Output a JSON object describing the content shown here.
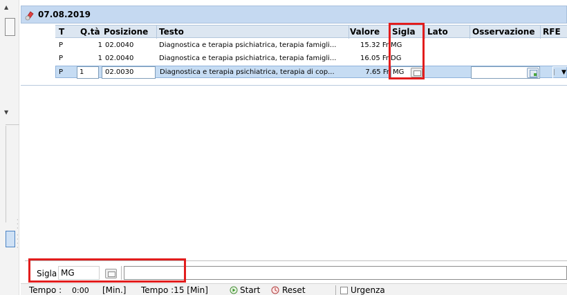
{
  "header": {
    "date": "07.08.2019"
  },
  "columns": {
    "t": "T",
    "qta": "Q.tà",
    "posizione": "Posizione",
    "testo": "Testo",
    "valore": "Valore",
    "sigla": "Sigla",
    "lato": "Lato",
    "osservazione": "Osservazione",
    "rfe": "RFE"
  },
  "rows": [
    {
      "t": "P",
      "qta": "1",
      "posizione": "02.0040",
      "testo": "Diagnostica e terapia psichiatrica, terapia famigli...",
      "valore": "15.32 Fr",
      "sigla": "MG"
    },
    {
      "t": "P",
      "qta": "1",
      "posizione": "02.0040",
      "testo": "Diagnostica e terapia psichiatrica, terapia famigli...",
      "valore": "16.05 Fr",
      "sigla": "DG"
    },
    {
      "t": "P",
      "qta": "1",
      "posizione": "02.0030",
      "testo": "Diagnostica e terapia psichiatrica, terapia di cop...",
      "valore": "7.65 Fr",
      "sigla": "MG"
    }
  ],
  "bottom": {
    "sigla_label": "Sigla :",
    "sigla_value": "MG"
  },
  "status": {
    "tempo_label": "Tempo :",
    "tempo_value": "0:00",
    "tempo_unit": "[Min.]",
    "tempo2": "Tempo :15 [Min]",
    "start": "Start",
    "reset": "Reset",
    "urgenza": "Urgenza"
  },
  "colors": {
    "header_bg": "#c5d9f1",
    "selected_row": "#c6dcf3",
    "highlight_red": "#e21d1d"
  }
}
